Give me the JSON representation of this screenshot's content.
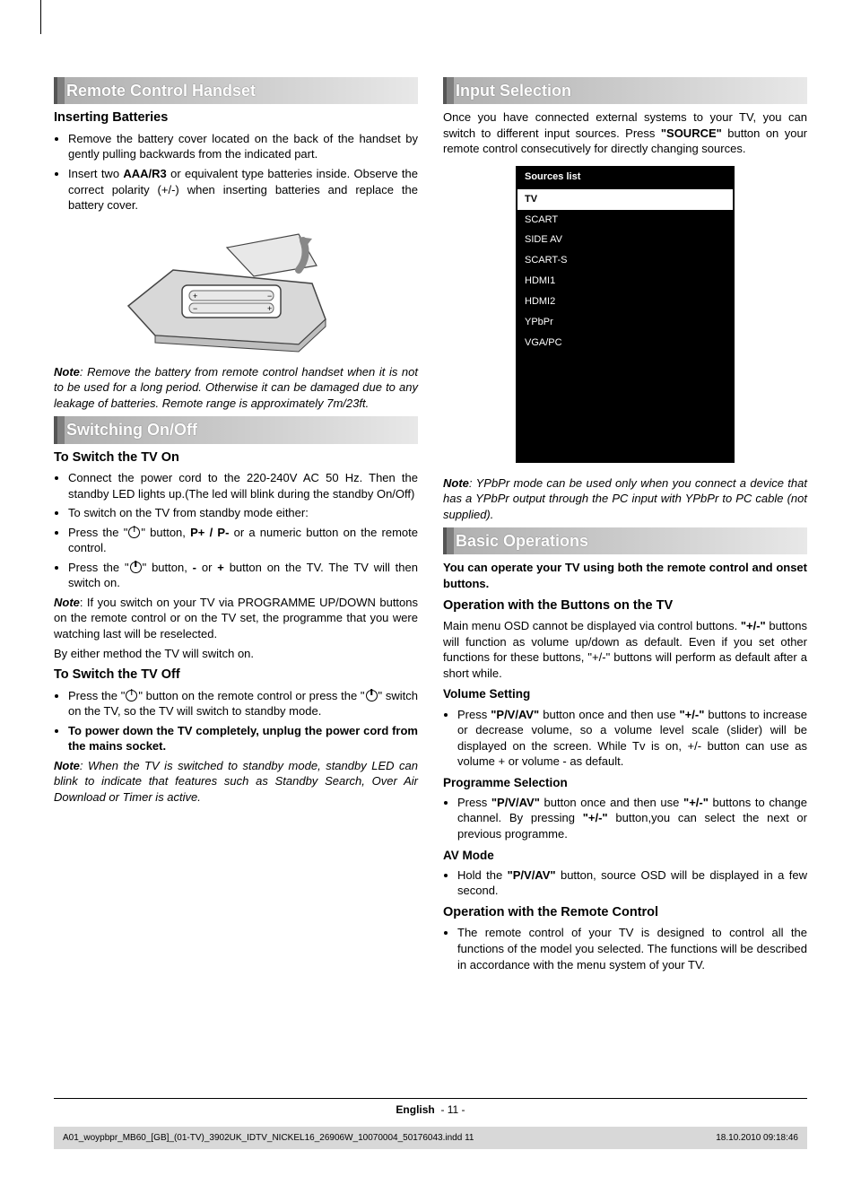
{
  "left": {
    "h1": "Remote Control Handset",
    "sub1": "Inserting Batteries",
    "li1": "Remove the battery cover located on the back of the handset by gently pulling backwards from the indicated part.",
    "li2_a": "Insert two ",
    "li2_b": "AAA/R3",
    "li2_c": " or equivalent type batteries inside. Observe the correct polarity (+/-) when inserting batteries and replace the battery cover.",
    "note1_a": "Note",
    "note1_b": ": Remove the battery from remote control handset when it is not to be used for a long period. Otherwise it can be damaged due to any leakage of batteries. Remote range is approximately 7m/23ft.",
    "h2": "Switching On/Off",
    "sub2": "To Switch the TV On",
    "li3": "Connect the power cord to the 220-240V AC 50 Hz. Then the standby LED lights up.(The led will blink during the standby On/Off)",
    "li4": "To switch on the TV from standby mode either:",
    "li5_a": "Press the \"",
    "li5_b": "\" button, ",
    "li5_c": "P+ / P-",
    "li5_d": " or a numeric button on the remote control.",
    "li6_a": "Press the \"",
    "li6_b": "\" button, ",
    "li6_c": "-",
    "li6_d": " or ",
    "li6_e": "+",
    "li6_f": " button on the TV. The TV will then switch on.",
    "note2_a": "Note",
    "note2_b": ": If you switch on your TV via PROGRAMME UP/DOWN buttons on the remote control or on the TV set, the programme that you were watching last will be reselected.",
    "p1": "By either method the TV will switch on.",
    "sub3": "To Switch the TV Off",
    "li7_a": "Press the \"",
    "li7_b": "\" button on the remote control or press the \"",
    "li7_c": "\" switch on the TV, so the TV will switch to standby mode.",
    "li8": "To power down the TV completely, unplug the power cord from the mains socket.",
    "note3_a": "Note",
    "note3_b": ": When the TV is switched to standby mode, standby LED can blink to indicate that features such as Standby Search, Over Air Download or Timer is active."
  },
  "right": {
    "h1": "Input Selection",
    "p1_a": "Once you have connected external systems to your TV, you can switch to different input sources. Press ",
    "p1_b": "\"SOURCE\"",
    "p1_c": " button on your remote control consecutively for directly changing sources.",
    "sources_title": "Sources list",
    "sources": [
      "TV",
      "SCART",
      "SIDE AV",
      "SCART-S",
      "HDMI1",
      "HDMI2",
      "YPbPr",
      "VGA/PC"
    ],
    "note1_a": "Note",
    "note1_b": ": YPbPr mode can be used only when you connect a device that has a YPbPr output through the PC input with YPbPr to PC cable (not supplied).",
    "h2": "Basic Operations",
    "p2": "You can operate your TV using both the remote control and onset buttons.",
    "sub1": "Operation with the Buttons on the TV",
    "p3_a": "Main menu OSD cannot be displayed via control buttons. ",
    "p3_b": "\"+/-\"",
    "p3_c": " buttons will function as volume up/down as default. Even if you set other functions for these buttons, \"+/-\" buttons will perform as default after a short while.",
    "sub2": "Volume Setting",
    "li1_a": "Press ",
    "li1_b": "\"P/V/AV\"",
    "li1_c": " button once and then use ",
    "li1_d": "\"+/-\"",
    "li1_e": " buttons to increase or decrease volume, so a volume level scale (slider) will be displayed on the screen. While Tv is on, +/- button can use as volume + or volume - as default.",
    "sub3": "Programme Selection",
    "li2_a": "Press ",
    "li2_b": "\"P/V/AV\"",
    "li2_c": " button once and then use ",
    "li2_d": "\"+/-\"",
    "li2_e": " buttons to change channel. By pressing ",
    "li2_f": "\"+/-\"",
    "li2_g": " button,you can select the next or previous programme.",
    "sub4": "AV Mode",
    "li3_a": "Hold the ",
    "li3_b": "\"P/V/AV\"",
    "li3_c": " button, source OSD will be displayed in a few second.",
    "sub5": "Operation with the Remote Control",
    "li4": "The remote control of your TV is designed to control all the functions of the model you selected. The functions will be described in accordance with the menu system of your TV."
  },
  "footer": {
    "lang": "English",
    "page": "- 11 -",
    "file": "A01_woypbpr_MB60_[GB]_(01-TV)_3902UK_IDTV_NICKEL16_26906W_10070004_50176043.indd   11",
    "date": "18.10.2010   09:18:46"
  }
}
